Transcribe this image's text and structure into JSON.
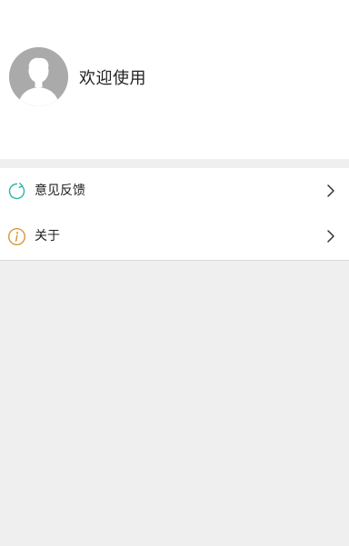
{
  "profile": {
    "welcome_text": "欢迎使用",
    "avatar_icon": "default-user-avatar-icon"
  },
  "menu": {
    "items": [
      {
        "label": "意见反馈",
        "icon": "feedback-refresh-icon",
        "icon_color": "#2fb3a6"
      },
      {
        "label": "关于",
        "icon": "info-icon",
        "icon_color": "#d49a3c"
      }
    ],
    "chevron_icon": "chevron-right-icon"
  },
  "colors": {
    "page_background": "#efefef",
    "card_background": "#ffffff",
    "avatar_background": "#aaaaaa"
  }
}
